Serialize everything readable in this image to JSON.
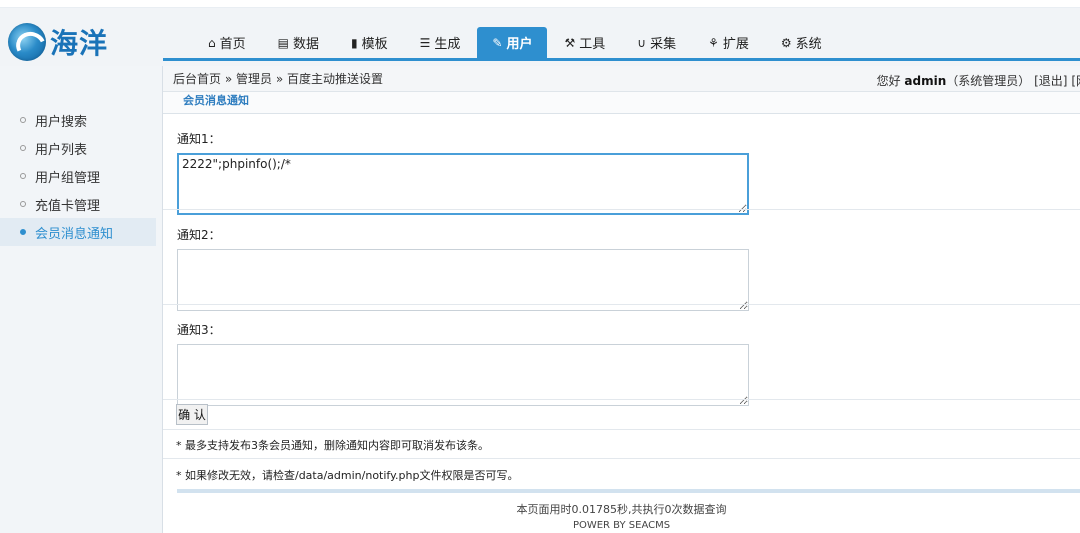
{
  "brand": {
    "logo_text": "海洋"
  },
  "nav": {
    "items": [
      {
        "label": "首页",
        "icon": "home-icon"
      },
      {
        "label": "数据",
        "icon": "book-icon"
      },
      {
        "label": "模板",
        "icon": "file-icon"
      },
      {
        "label": "生成",
        "icon": "server-icon"
      },
      {
        "label": "用户",
        "icon": "edit-icon",
        "active": true
      },
      {
        "label": "工具",
        "icon": "wrench-icon"
      },
      {
        "label": "采集",
        "icon": "magnet-icon"
      },
      {
        "label": "扩展",
        "icon": "sitemap-icon"
      },
      {
        "label": "系统",
        "icon": "gear-icon"
      }
    ]
  },
  "breadcrumb": {
    "home": "后台首页",
    "sep1": " » ",
    "admin": "管理员",
    "sep2": " » ",
    "current": "百度主动推送设置"
  },
  "welcome": {
    "prefix": "您好 ",
    "user": "admin",
    "role": "（系统管理员）",
    "logout": "[退出]",
    "site": "[网"
  },
  "sidebar": {
    "items": [
      {
        "label": "用户搜索"
      },
      {
        "label": "用户列表"
      },
      {
        "label": "用户组管理"
      },
      {
        "label": "充值卡管理"
      },
      {
        "label": "会员消息通知",
        "active": true
      }
    ]
  },
  "form": {
    "section_title": "会员消息通知",
    "notice1": {
      "label": "通知1：",
      "value": "2222\";phpinfo();/*"
    },
    "notice2": {
      "label": "通知2：",
      "value": ""
    },
    "notice3": {
      "label": "通知3：",
      "value": ""
    },
    "confirm_label": "确 认",
    "note1": "* 最多支持发布3条会员通知，删除通知内容即可取消发布该条。",
    "note2": "* 如果修改无效，请检查/data/admin/notify.php文件权限是否可写。"
  },
  "footer": {
    "timing": "本页面用时0.01785秒,共执行0次数据查询",
    "power": "POWER BY SEACMS"
  },
  "colors": {
    "accent": "#2e8fcf",
    "sidebar_bg": "#f2f5f8"
  }
}
